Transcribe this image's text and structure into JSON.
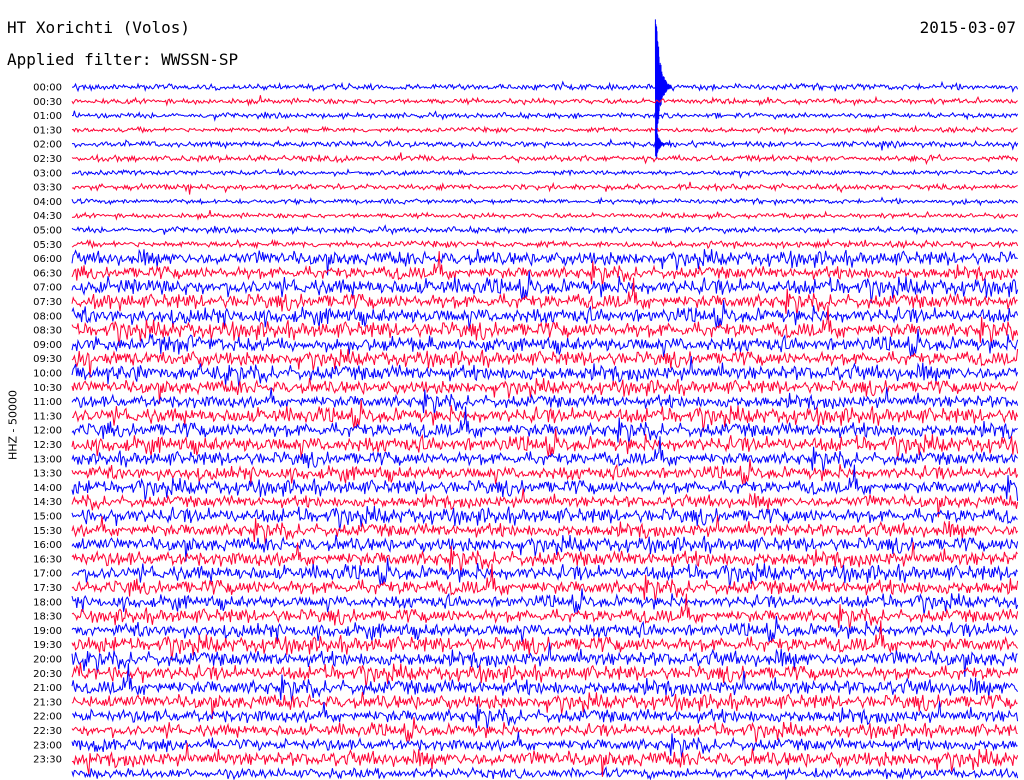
{
  "header": {
    "station": "HT Xorichti (Volos)",
    "date": "2015-03-07",
    "filter": "Applied filter: WWSSN-SP"
  },
  "colors": {
    "trace_a": "#0000ff",
    "trace_b": "#ff0033",
    "background": "#ffffff"
  },
  "chart_data": {
    "type": "line",
    "subtype": "helicorder",
    "ylabel": "HHZ - 50000",
    "grid": false,
    "legend": "none",
    "rows_per_day": 48,
    "minutes_per_row": 30,
    "series_colors": [
      "trace_a",
      "trace_b"
    ],
    "y_tick_labels": [
      "00:00",
      "00:30",
      "01:00",
      "01:30",
      "02:00",
      "02:30",
      "03:00",
      "03:30",
      "04:00",
      "04:30",
      "05:00",
      "05:30",
      "06:00",
      "06:30",
      "07:00",
      "07:30",
      "08:00",
      "08:30",
      "09:00",
      "09:30",
      "10:00",
      "10:30",
      "11:00",
      "11:30",
      "12:00",
      "12:30",
      "13:00",
      "13:30",
      "14:00",
      "14:30",
      "15:00",
      "15:30",
      "16:00",
      "16:30",
      "17:00",
      "17:30",
      "18:00",
      "18:30",
      "19:00",
      "19:30",
      "20:00",
      "20:30",
      "21:00",
      "21:30",
      "22:00",
      "22:30",
      "23:00",
      "23:30"
    ],
    "noise_level_by_row": [
      1,
      1,
      1,
      1,
      1,
      1,
      1,
      1,
      1,
      1,
      1,
      1,
      1,
      1,
      1,
      1,
      1,
      1,
      1,
      1,
      1,
      1,
      1,
      1,
      1,
      1,
      1,
      1,
      1,
      1,
      1,
      1,
      1,
      1,
      1,
      1,
      1,
      1,
      1,
      1,
      1,
      1,
      1,
      1,
      1,
      1,
      1,
      1
    ],
    "events": [
      {
        "row": "00:00",
        "minute": 18.5,
        "peak_amplitude": "off-scale"
      },
      {
        "row": "02:00",
        "minute": 18.5,
        "peak_amplitude": "large"
      }
    ]
  }
}
